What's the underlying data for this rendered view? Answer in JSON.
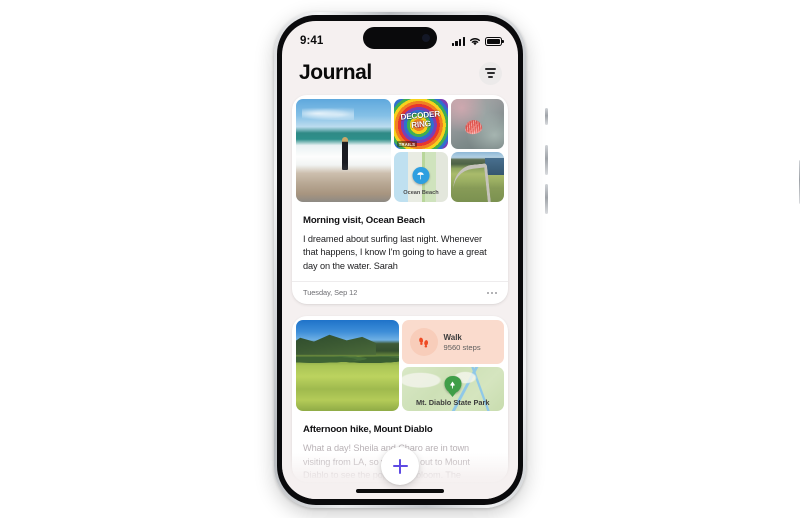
{
  "status_bar": {
    "time": "9:41",
    "signal_icon": "cellular-signal-icon",
    "wifi_icon": "wifi-icon",
    "battery_icon": "battery-full-icon"
  },
  "header": {
    "title": "Journal",
    "filter_icon": "filter-sort-icon"
  },
  "entries": [
    {
      "title": "Morning visit, Ocean Beach",
      "text": "I dreamed about surfing last night. Whenever that happens, I know I'm going to have a great day on the water. Sarah",
      "date": "Tuesday, Sep 12",
      "more_icon": "more-options-icon",
      "media": {
        "photo_main": "surfer-on-beach-photo",
        "album": {
          "name": "album-art-tile",
          "title": "DECODER RING",
          "subtitle": "TRAILS"
        },
        "photo_shell": "seashell-on-rocks-photo",
        "map": {
          "name": "ocean-beach-map-tile",
          "label": "Ocean Beach",
          "pin_icon": "beach-umbrella-pin-icon",
          "pin_color": "#2e9fe0"
        },
        "photo_road": "coastal-road-photo"
      }
    },
    {
      "title": "Afternoon hike, Mount Diablo",
      "text": "What a day! Sheila and Charo are in town visiting from LA, so we drove out to Mount Diablo to see the poppies in bloom. The",
      "media": {
        "photo_main": "mount-diablo-meadow-photo",
        "walk": {
          "name": "walk-activity-widget",
          "title": "Walk",
          "steps": "9560 steps",
          "icon": "footprints-icon",
          "background": "#fadbcd",
          "icon_color": "#ef4a23"
        },
        "map": {
          "name": "mt-diablo-map-tile",
          "label": "Mt. Diablo State Park",
          "pin_icon": "park-tree-pin-icon",
          "pin_color": "#3f9e48"
        }
      }
    }
  ],
  "compose": {
    "icon": "plus-icon",
    "color": "#5e4ae3"
  },
  "device": {
    "dynamic_island": "dynamic-island",
    "home_indicator": "home-indicator",
    "buttons": [
      "silence-switch",
      "volume-up-button",
      "volume-down-button",
      "power-button"
    ]
  }
}
